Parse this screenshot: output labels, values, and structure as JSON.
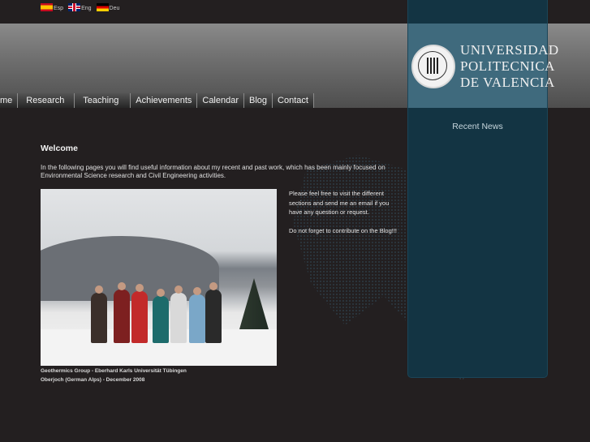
{
  "languages": [
    {
      "label": "Esp"
    },
    {
      "label": "Eng"
    },
    {
      "label": "Deu"
    }
  ],
  "logo": {
    "line1": "UNIVERSIDAD",
    "line2": "POLITECNICA",
    "line3": "DE VALENCIA"
  },
  "nav": {
    "items": [
      "me",
      "Research",
      "Teaching",
      "Achievements",
      "Calendar",
      "Blog",
      "Contact"
    ]
  },
  "sidebar": {
    "recent_news": "Recent News"
  },
  "main": {
    "title": "Welcome",
    "intro": "In the following pages you will find useful information about my recent and past work, which has been mainly focused on Environmental Science research and Civil Engineering activities.",
    "side_p1": "Please feel free to visit the different sections and send me an email if you have any question or request.",
    "side_p2": "Do not forget to contribute on the Blog!!!",
    "caption_line1": "Geothermics Group - Eberhard Karls Universität Tübingen",
    "caption_line2": "Oberjoch (German Alps) - December 2008"
  },
  "colors": {
    "background": "#231f20",
    "panel": "#133443",
    "panel_header": "#3f6a7d"
  }
}
